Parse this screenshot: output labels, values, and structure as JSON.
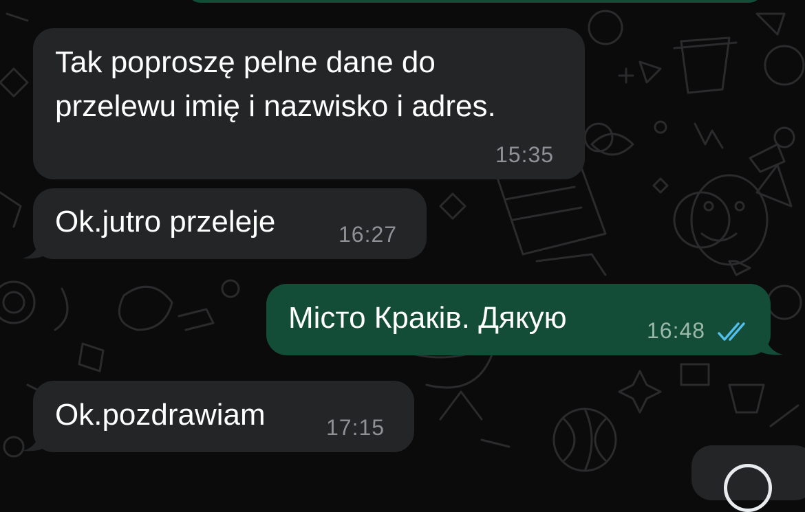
{
  "chat": {
    "messages": [
      {
        "direction": "incoming",
        "lines": [
          "Tak poproszę pelne dane do",
          "przelewu imię i nazwisko i adres."
        ],
        "time": "15:35"
      },
      {
        "direction": "incoming",
        "lines": [
          "Ok.jutro przeleje"
        ],
        "time": "16:27"
      },
      {
        "direction": "outgoing",
        "lines": [
          "Місто Краків. Дякую"
        ],
        "time": "16:48",
        "status": "double-check-read"
      },
      {
        "direction": "incoming",
        "lines": [
          "Ok.pozdrawiam"
        ],
        "time": "17:15"
      }
    ]
  },
  "colors": {
    "background": "#0b0b0c",
    "incoming_bubble": "#232527",
    "outgoing_bubble": "#144d37",
    "read_ticks": "#53bdeb",
    "timestamp": "#8e9296"
  },
  "icons": {
    "read_receipt": "double-check-icon",
    "partial_button": "circle-button-icon"
  }
}
